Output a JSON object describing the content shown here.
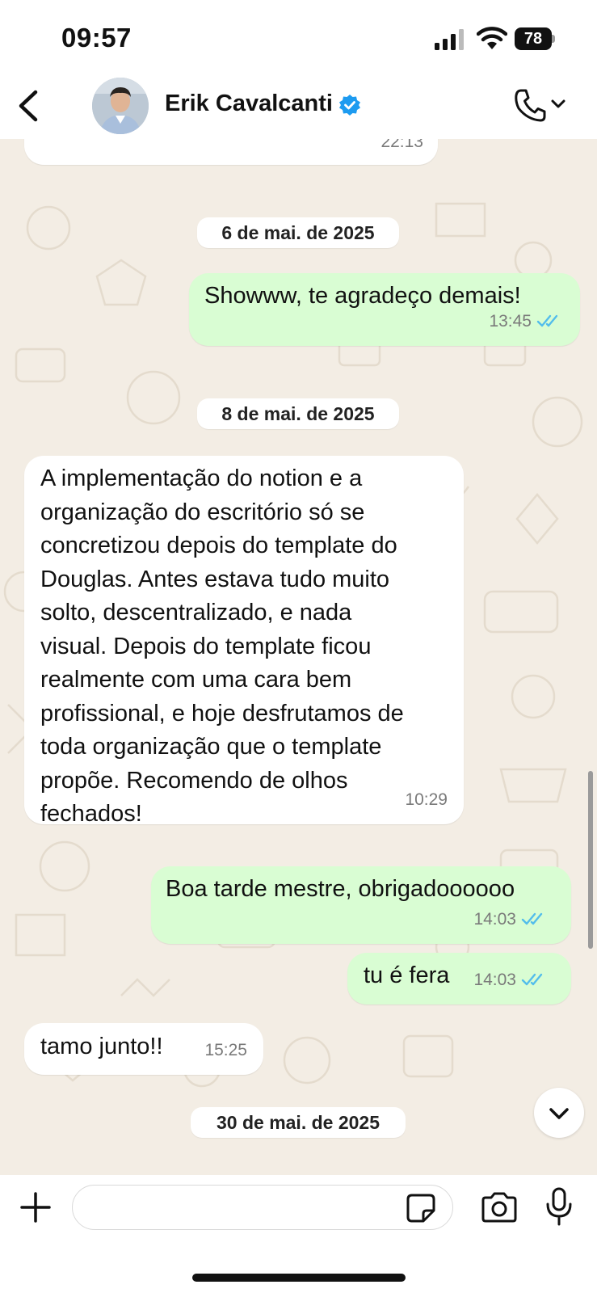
{
  "status_bar": {
    "time": "09:57",
    "battery": "78",
    "icons": [
      "signal-icon",
      "wifi-icon",
      "battery-icon"
    ]
  },
  "header": {
    "contact_name": "Erik Cavalcanti",
    "verified": true,
    "icons": [
      "back-icon",
      "avatar",
      "verified-badge-icon",
      "phone-icon",
      "chevron-down-icon"
    ]
  },
  "chat": {
    "prev_message_time": "22:13",
    "dates": {
      "d1": "6 de mai. de 2025",
      "d2": "8 de mai. de 2025",
      "d3": "30 de mai. de 2025"
    },
    "messages": [
      {
        "direction": "out",
        "text": "Showww, te agradeço demais!",
        "time": "13:45",
        "status": "read"
      },
      {
        "direction": "in",
        "lines": [
          "A implementação do notion e a",
          "organização do escritório só se",
          "concretizou depois do template do",
          "Douglas. Antes estava tudo muito",
          "solto, descentralizado, e nada",
          "visual. Depois do template ficou",
          "realmente com uma cara bem",
          "profissional, e hoje desfrutamos de",
          "toda organização que o template",
          "propõe. Recomendo de olhos",
          "fechados!"
        ],
        "time": "10:29"
      },
      {
        "direction": "out",
        "text": "Boa tarde mestre, obrigadoooooo",
        "time": "14:03",
        "status": "read"
      },
      {
        "direction": "out",
        "text": "tu é fera",
        "time": "14:03",
        "status": "read"
      },
      {
        "direction": "in",
        "text": "tamo junto!!",
        "time": "15:25"
      }
    ]
  },
  "input_bar": {
    "placeholder": "",
    "icons": [
      "plus-icon",
      "sticker-icon",
      "camera-icon",
      "microphone-icon"
    ]
  },
  "colors": {
    "outgoing_bubble": "#d9fdd3",
    "incoming_bubble": "#ffffff",
    "wallpaper": "#f3ede4",
    "read_ticks": "#53bdeb",
    "verified_badge": "#1d9bf0"
  }
}
